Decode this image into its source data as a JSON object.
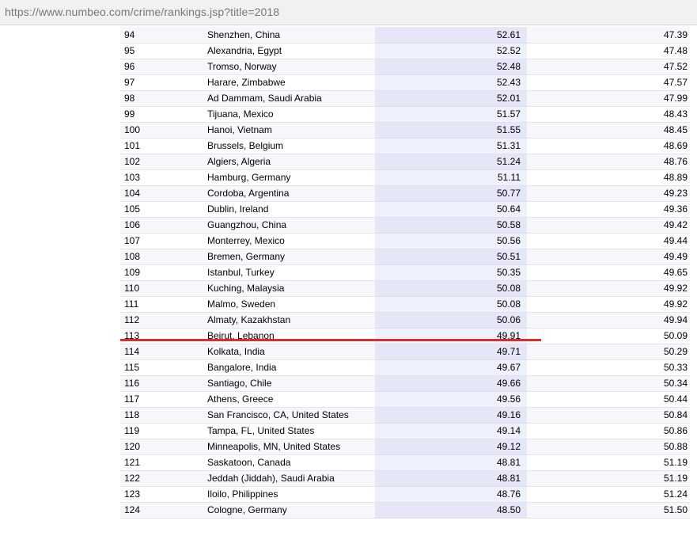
{
  "browser": {
    "url": "https://www.numbeo.com/crime/rankings.jsp?title=2018"
  },
  "annotation": {
    "marker_color": "#e02b2b"
  },
  "rankings": [
    {
      "rank": "94",
      "city": "Shenzhen, China",
      "crime_index": "52.61",
      "safety_index": "47.39"
    },
    {
      "rank": "95",
      "city": "Alexandria, Egypt",
      "crime_index": "52.52",
      "safety_index": "47.48"
    },
    {
      "rank": "96",
      "city": "Tromso, Norway",
      "crime_index": "52.48",
      "safety_index": "47.52"
    },
    {
      "rank": "97",
      "city": "Harare, Zimbabwe",
      "crime_index": "52.43",
      "safety_index": "47.57"
    },
    {
      "rank": "98",
      "city": "Ad Dammam, Saudi Arabia",
      "crime_index": "52.01",
      "safety_index": "47.99"
    },
    {
      "rank": "99",
      "city": "Tijuana, Mexico",
      "crime_index": "51.57",
      "safety_index": "48.43"
    },
    {
      "rank": "100",
      "city": "Hanoi, Vietnam",
      "crime_index": "51.55",
      "safety_index": "48.45"
    },
    {
      "rank": "101",
      "city": "Brussels, Belgium",
      "crime_index": "51.31",
      "safety_index": "48.69"
    },
    {
      "rank": "102",
      "city": "Algiers, Algeria",
      "crime_index": "51.24",
      "safety_index": "48.76"
    },
    {
      "rank": "103",
      "city": "Hamburg, Germany",
      "crime_index": "51.11",
      "safety_index": "48.89"
    },
    {
      "rank": "104",
      "city": "Cordoba, Argentina",
      "crime_index": "50.77",
      "safety_index": "49.23"
    },
    {
      "rank": "105",
      "city": "Dublin, Ireland",
      "crime_index": "50.64",
      "safety_index": "49.36"
    },
    {
      "rank": "106",
      "city": "Guangzhou, China",
      "crime_index": "50.58",
      "safety_index": "49.42"
    },
    {
      "rank": "107",
      "city": "Monterrey, Mexico",
      "crime_index": "50.56",
      "safety_index": "49.44"
    },
    {
      "rank": "108",
      "city": "Bremen, Germany",
      "crime_index": "50.51",
      "safety_index": "49.49"
    },
    {
      "rank": "109",
      "city": "Istanbul, Turkey",
      "crime_index": "50.35",
      "safety_index": "49.65"
    },
    {
      "rank": "110",
      "city": "Kuching, Malaysia",
      "crime_index": "50.08",
      "safety_index": "49.92"
    },
    {
      "rank": "111",
      "city": "Malmo, Sweden",
      "crime_index": "50.08",
      "safety_index": "49.92"
    },
    {
      "rank": "112",
      "city": "Almaty, Kazakhstan",
      "crime_index": "50.06",
      "safety_index": "49.94"
    },
    {
      "rank": "113",
      "city": "Beirut, Lebanon",
      "crime_index": "49.91",
      "safety_index": "50.09"
    },
    {
      "rank": "114",
      "city": "Kolkata, India",
      "crime_index": "49.71",
      "safety_index": "50.29"
    },
    {
      "rank": "115",
      "city": "Bangalore, India",
      "crime_index": "49.67",
      "safety_index": "50.33"
    },
    {
      "rank": "116",
      "city": "Santiago, Chile",
      "crime_index": "49.66",
      "safety_index": "50.34"
    },
    {
      "rank": "117",
      "city": "Athens, Greece",
      "crime_index": "49.56",
      "safety_index": "50.44"
    },
    {
      "rank": "118",
      "city": "San Francisco, CA, United States",
      "crime_index": "49.16",
      "safety_index": "50.84"
    },
    {
      "rank": "119",
      "city": "Tampa, FL, United States",
      "crime_index": "49.14",
      "safety_index": "50.86"
    },
    {
      "rank": "120",
      "city": "Minneapolis, MN, United States",
      "crime_index": "49.12",
      "safety_index": "50.88"
    },
    {
      "rank": "121",
      "city": "Saskatoon, Canada",
      "crime_index": "48.81",
      "safety_index": "51.19"
    },
    {
      "rank": "122",
      "city": "Jeddah (Jiddah), Saudi Arabia",
      "crime_index": "48.81",
      "safety_index": "51.19"
    },
    {
      "rank": "123",
      "city": "Iloilo, Philippines",
      "crime_index": "48.76",
      "safety_index": "51.24"
    },
    {
      "rank": "124",
      "city": "Cologne, Germany",
      "crime_index": "48.50",
      "safety_index": "51.50"
    }
  ]
}
